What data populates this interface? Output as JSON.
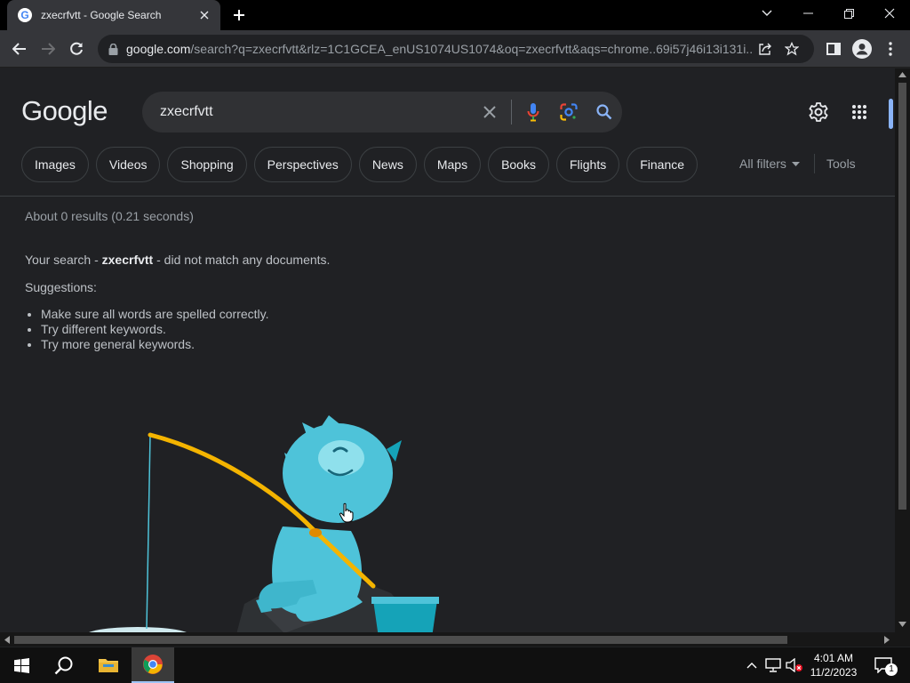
{
  "browser": {
    "tab_title": "zxecrfvtt - Google Search",
    "url_domain": "google.com",
    "url_rest": "/search?q=zxecrfvtt&rlz=1C1GCEA_enUS1074US1074&oq=zxecrfvtt&aqs=chrome..69i57j46i13i131i..."
  },
  "google": {
    "logo": "Google",
    "query": "zxecrfvtt",
    "chips": [
      "Images",
      "Videos",
      "Shopping",
      "Perspectives",
      "News",
      "Maps",
      "Books",
      "Flights",
      "Finance"
    ],
    "all_filters": "All filters",
    "tools": "Tools",
    "result_stats": "About 0 results (0.21 seconds)",
    "no_match_prefix": "Your search - ",
    "no_match_term": "zxecrfvtt",
    "no_match_suffix": " - did not match any documents.",
    "suggestions_label": "Suggestions:",
    "suggestions": [
      "Make sure all words are spelled correctly.",
      "Try different keywords.",
      "Try more general keywords."
    ]
  },
  "taskbar": {
    "time": "4:01 AM",
    "date": "11/2/2023",
    "notification_count": "1"
  },
  "colors": {
    "page_bg": "#202124",
    "chrome_frame": "#000000",
    "toolbar": "#35363a",
    "accent_blue": "#8ab4f8",
    "yeti": "#4ec3d9"
  }
}
